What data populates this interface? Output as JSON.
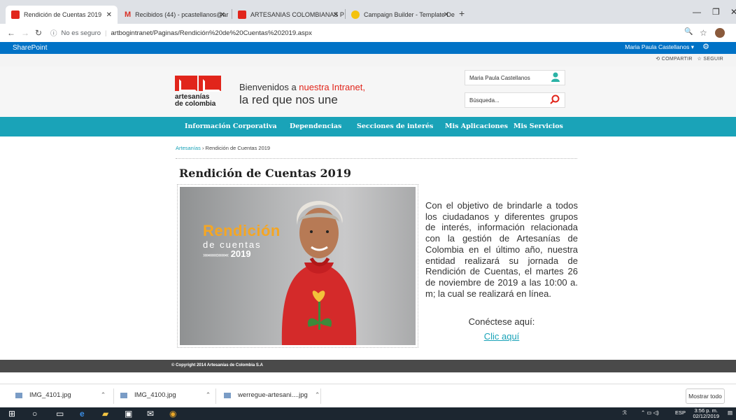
{
  "browser": {
    "tabs": [
      {
        "title": "Rendición de Cuentas 2019",
        "active": true
      },
      {
        "title": "Recibidos (44) - pcastellanos@ar",
        "active": false
      },
      {
        "title": "ARTESANIAS COLOMBIANAS PL",
        "active": false
      },
      {
        "title": "Campaign Builder - Template De",
        "active": false
      }
    ],
    "not_secure": "No es seguro",
    "url": "artbogintranet/Paginas/Rendición%20de%20Cuentas%202019.aspx"
  },
  "sharepoint": {
    "brand": "SharePoint",
    "user": "Maria Paula Castellanos ▾",
    "share": "COMPARTIR",
    "follow": "SEGUIR"
  },
  "header": {
    "logo_line1": "artesanías",
    "logo_line2": "de colombia",
    "welcome_prefix": "Bienvenidos a ",
    "welcome_highlight": "nuestra Intranet,",
    "tagline": "la red que nos une",
    "user_name": "Maria Paula Castellanos",
    "search_placeholder": "Búsqueda..."
  },
  "nav": [
    "Información Corporativa",
    "Dependencias",
    "Secciones de interés",
    "Mis Aplicaciones",
    "Mis Servicios"
  ],
  "breadcrumb": {
    "root": "Artesanías",
    "sep": " › ",
    "current": "Rendición de Cuentas 2019"
  },
  "page": {
    "title": "Rendición de Cuentas 2019",
    "banner": {
      "line1": "Rendición",
      "line2": "de cuentas",
      "year": "2019"
    },
    "body": "Con el objetivo de brindarle a todos los ciudadanos y diferentes grupos de interés, información relacionada con la gestión de Artesanías de Colombia en el último año, nuestra entidad realizará su jornada de Rendición de Cuentas, el martes 26 de noviembre de 2019 a las 10:00 a. m; la cual se realizará en línea.",
    "connect": "Conéctese aquí:",
    "link": "Clic aquí"
  },
  "footer": "© Copyright 2014 Artesanías de Colombia S.A",
  "downloads": {
    "files": [
      "IMG_4101.jpg",
      "IMG_4100.jpg",
      "werregue-artesani....jpg"
    ],
    "show_all": "Mostrar todo"
  },
  "taskbar": {
    "lang": "ESP",
    "time": "3:56 p. m.",
    "date": "02/12/2019"
  },
  "colors": {
    "accent": "#1aa3b8",
    "brand_red": "#e1251b",
    "sharepoint_blue": "#0072c6"
  }
}
